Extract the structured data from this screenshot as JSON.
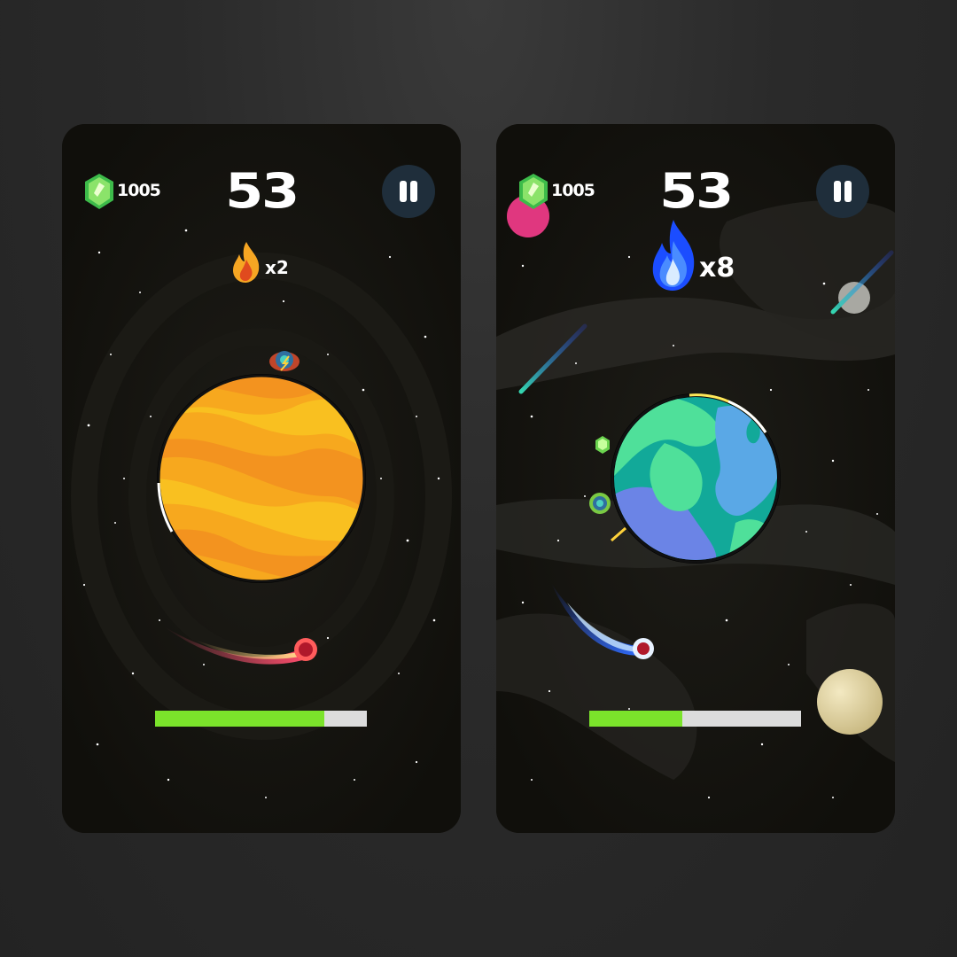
{
  "screens": [
    {
      "gems": "1005",
      "score": "53",
      "multiplier": "x2",
      "progress": 0.8,
      "flame": "orange-flame-icon",
      "planet": "orange-striped-planet",
      "colors": {
        "progress_fill": "#7be32b",
        "progress_track": "#dcdcdc",
        "pause_bg": "#1f2e3b"
      }
    },
    {
      "gems": "1005",
      "score": "53",
      "multiplier": "x8",
      "progress": 0.44,
      "flame": "blue-flame-icon",
      "planet": "earth-like-planet",
      "colors": {
        "progress_fill": "#7be32b",
        "progress_track": "#dcdcdc",
        "pause_bg": "#1f2e3b"
      }
    }
  ]
}
